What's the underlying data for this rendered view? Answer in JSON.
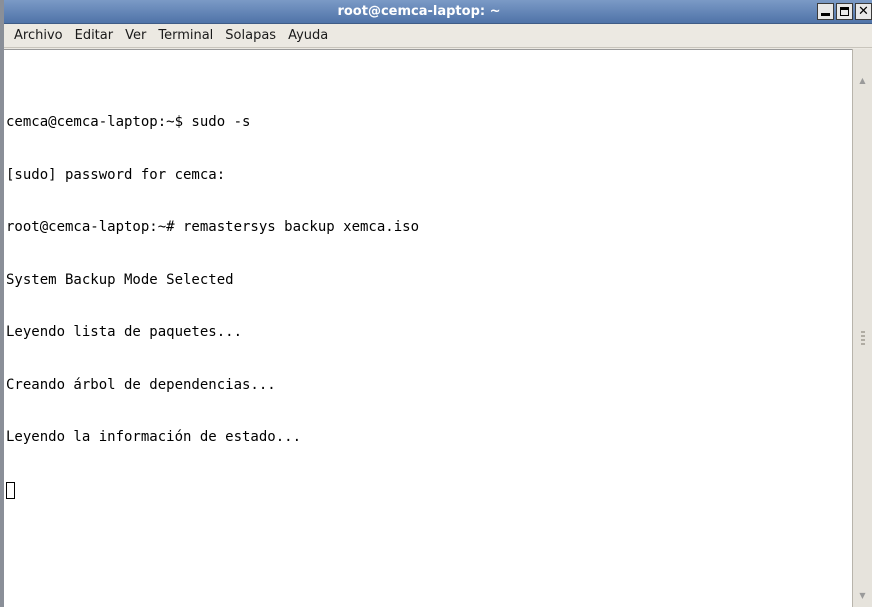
{
  "window": {
    "title": "root@cemca-laptop: ~",
    "controls": {
      "minimize_icon": "minimize-icon",
      "maximize_icon": "maximize-icon",
      "close_icon": "close-icon",
      "close_glyph": "✕"
    }
  },
  "menubar": {
    "items": [
      {
        "label": "Archivo"
      },
      {
        "label": "Editar"
      },
      {
        "label": "Ver"
      },
      {
        "label": "Terminal"
      },
      {
        "label": "Solapas"
      },
      {
        "label": "Ayuda"
      }
    ]
  },
  "terminal": {
    "lines": [
      "cemca@cemca-laptop:~$ sudo -s",
      "[sudo] password for cemca:",
      "root@cemca-laptop:~# remastersys backup xemca.iso",
      "System Backup Mode Selected",
      "Leyendo lista de paquetes...",
      "Creando árbol de dependencias...",
      "Leyendo la información de estado..."
    ]
  },
  "scrollbar": {
    "up_glyph": "▲",
    "down_glyph": "▼"
  },
  "colors": {
    "titlebar": "#5b7fb5",
    "background": "#ffffff",
    "text": "#000000"
  }
}
